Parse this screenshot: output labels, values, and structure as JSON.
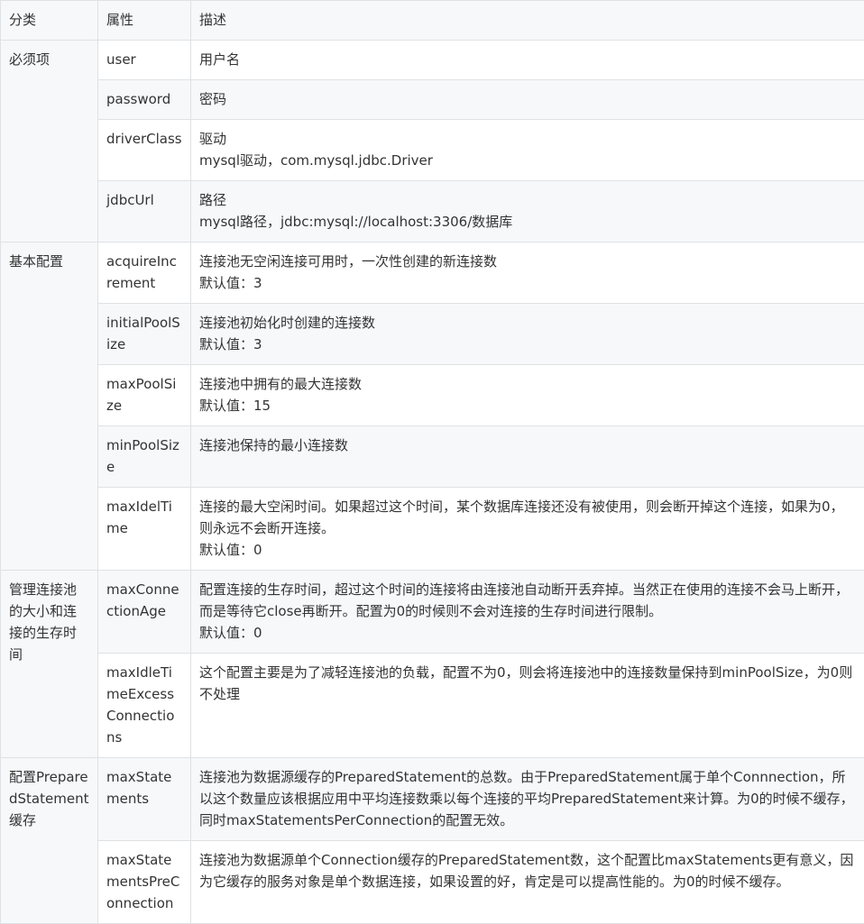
{
  "header": {
    "category": "分类",
    "property": "属性",
    "description": "描述"
  },
  "groups": [
    {
      "name": "必须项",
      "rows": [
        {
          "property": "user",
          "lines": [
            "用户名"
          ]
        },
        {
          "property": "password",
          "lines": [
            "密码"
          ]
        },
        {
          "property": "driverClass",
          "lines": [
            "驱动",
            "mysql驱动，com.mysql.jdbc.Driver"
          ]
        },
        {
          "property": "jdbcUrl",
          "lines": [
            "路径",
            "mysql路径，jdbc:mysql://localhost:3306/数据库"
          ]
        }
      ]
    },
    {
      "name": "基本配置",
      "rows": [
        {
          "property": "acquireIncrement",
          "lines": [
            "连接池无空闲连接可用时，一次性创建的新连接数",
            "默认值：3"
          ]
        },
        {
          "property": "initialPoolSize",
          "lines": [
            "连接池初始化时创建的连接数",
            "默认值：3"
          ]
        },
        {
          "property": "maxPoolSize",
          "lines": [
            "连接池中拥有的最大连接数",
            "默认值：15"
          ]
        },
        {
          "property": "minPoolSize",
          "lines": [
            "连接池保持的最小连接数"
          ]
        },
        {
          "property": "maxIdelTime",
          "lines": [
            "连接的最大空闲时间。如果超过这个时间，某个数据库连接还没有被使用，则会断开掉这个连接，如果为0，则永远不会断开连接。",
            "默认值：0"
          ]
        }
      ]
    },
    {
      "name": "管理连接池的大小和连接的生存时间",
      "rows": [
        {
          "property": "maxConnectionAge",
          "lines": [
            "配置连接的生存时间，超过这个时间的连接将由连接池自动断开丢弃掉。当然正在使用的连接不会马上断开，而是等待它close再断开。配置为0的时候则不会对连接的生存时间进行限制。",
            "默认值：0"
          ]
        },
        {
          "property": "maxIdleTimeExcessConnections",
          "lines": [
            "这个配置主要是为了减轻连接池的负载，配置不为0，则会将连接池中的连接数量保持到minPoolSize，为0则不处理"
          ]
        }
      ]
    },
    {
      "name": "配置PreparedStatement缓存",
      "rows": [
        {
          "property": "maxStatements",
          "lines": [
            "连接池为数据源缓存的PreparedStatement的总数。由于PreparedStatement属于单个Connnection，所以这个数量应该根据应用中平均连接数乘以每个连接的平均PreparedStatement来计算。为0的时候不缓存，同时maxStatementsPerConnection的配置无效。"
          ]
        },
        {
          "property": "maxStatementsPreConnection",
          "lines": [
            "连接池为数据源单个Connection缓存的PreparedStatement数，这个配置比maxStatements更有意义，因为它缓存的服务对象是单个数据连接，如果设置的好，肯定是可以提高性能的。为0的时候不缓存。"
          ]
        }
      ]
    }
  ]
}
